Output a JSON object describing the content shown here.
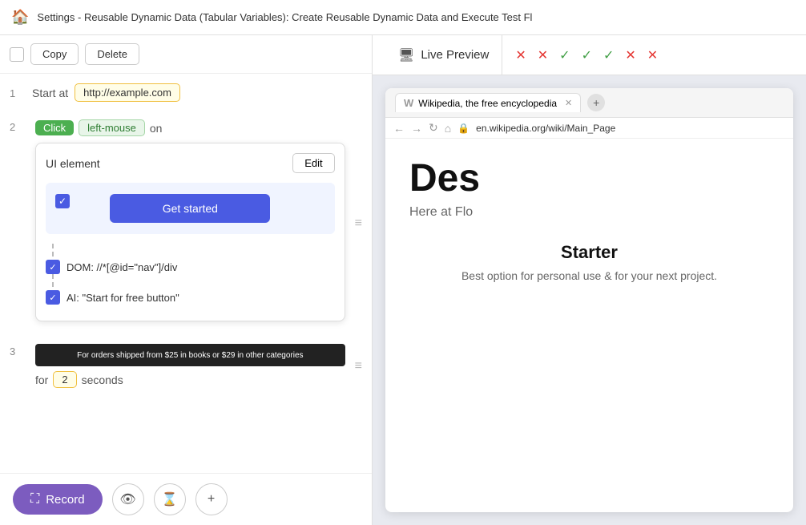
{
  "titleBar": {
    "title": "Settings - Reusable Dynamic Data (Tabular Variables): Create Reusable Dynamic Data and Execute Test Fl"
  },
  "toolbar": {
    "copy_label": "Copy",
    "delete_label": "Delete"
  },
  "steps": {
    "step1": {
      "num": "1",
      "start_text": "Start at",
      "url": "http://example.com"
    },
    "step2": {
      "num": "2",
      "click_label": "Click",
      "mouse_label": "left-mouse",
      "on_text": "on",
      "ui_element_label": "UI element",
      "edit_label": "Edit",
      "get_started_label": "Get started",
      "dom_label": "DOM: //*[@id=\"nav\"]/div",
      "ai_label": "AI:  \"Start for free button\""
    },
    "step3": {
      "num": "3",
      "scroll_text": "For orders shipped from $25 in books or $29 in other categories",
      "for_text": "for",
      "seconds_value": "2",
      "seconds_text": "seconds"
    }
  },
  "bottomBar": {
    "record_label": "Record"
  },
  "livePreview": {
    "title": "Live Preview",
    "tab_icons": [
      "✕",
      "✕",
      "✓",
      "✓",
      "✓",
      "✕",
      "✕"
    ]
  },
  "browser": {
    "tab_title": "Wikipedia, the free encyclopedia",
    "url": "en.wikipedia.org/wiki/Main_Page",
    "big_title": "Des",
    "sub_title": "Here at Flo",
    "starter_title": "Starter",
    "starter_desc": "Best option for personal use & for\nyour next project."
  }
}
